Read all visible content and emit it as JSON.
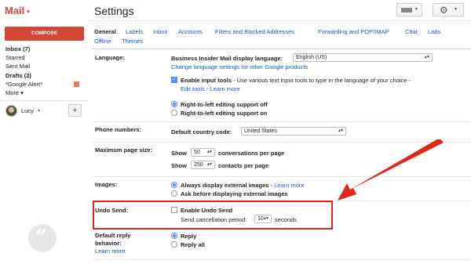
{
  "brand": {
    "name": "Mail",
    "caret": "▾"
  },
  "compose_label": "COMPOSE",
  "folders": [
    {
      "label": "Inbox (7)"
    },
    {
      "label": "Starred"
    },
    {
      "label": "Sent Mail"
    },
    {
      "label": "Drafts (2)"
    },
    {
      "label": "*Google Alert*"
    },
    {
      "label": "More ▾"
    }
  ],
  "user": {
    "name": "Lucy",
    "caret": "▾",
    "add": "+"
  },
  "hangouts_glyph": "“",
  "header": {
    "title": "Settings",
    "gear_glyph": "⚙",
    "caret": "▾"
  },
  "tabs": [
    "General",
    "Labels",
    "Inbox",
    "Accounts",
    "Filters and Blocked Addresses",
    "Forwarding and POP/IMAP",
    "Chat",
    "Labs",
    "Offline",
    "Themes"
  ],
  "language": {
    "label": "Language:",
    "display_label": "Business Insider Mail display language:",
    "display_value": "English (US)",
    "change_link": "Change language settings for other Google products",
    "input_tools_label": "Enable input tools",
    "input_tools_desc": " - Use various text input tools to type in the language of your choice -",
    "edit_tools": "Edit tools",
    "learn_more": "Learn more",
    "rtl_off": "Right-to-left editing support off",
    "rtl_on": "Right-to-left editing support on"
  },
  "phone": {
    "label": "Phone numbers:",
    "field_label": "Default country code:",
    "value": "United States"
  },
  "page_size": {
    "label": "Maximum page size:",
    "show": "Show",
    "conv_value": "50",
    "conv_suffix": "conversations per page",
    "contacts_value": "250",
    "contacts_suffix": "contacts per page"
  },
  "images": {
    "label": "Images:",
    "always": "Always display external images",
    "learn_more": "Learn more",
    "ask": "Ask before displaying external images"
  },
  "undo_send": {
    "label": "Undo Send:",
    "enable_label": "Enable Undo Send",
    "period_label": "Send cancellation period:",
    "period_value": "10",
    "period_suffix": "seconds"
  },
  "reply": {
    "label_line1": "Default reply",
    "label_line2": "behavior:",
    "learn_more": "Learn more",
    "reply": "Reply",
    "reply_all": "Reply all"
  },
  "colors": {
    "highlight": "#e3261a",
    "brand": "#d14836",
    "link": "#1155cc"
  }
}
